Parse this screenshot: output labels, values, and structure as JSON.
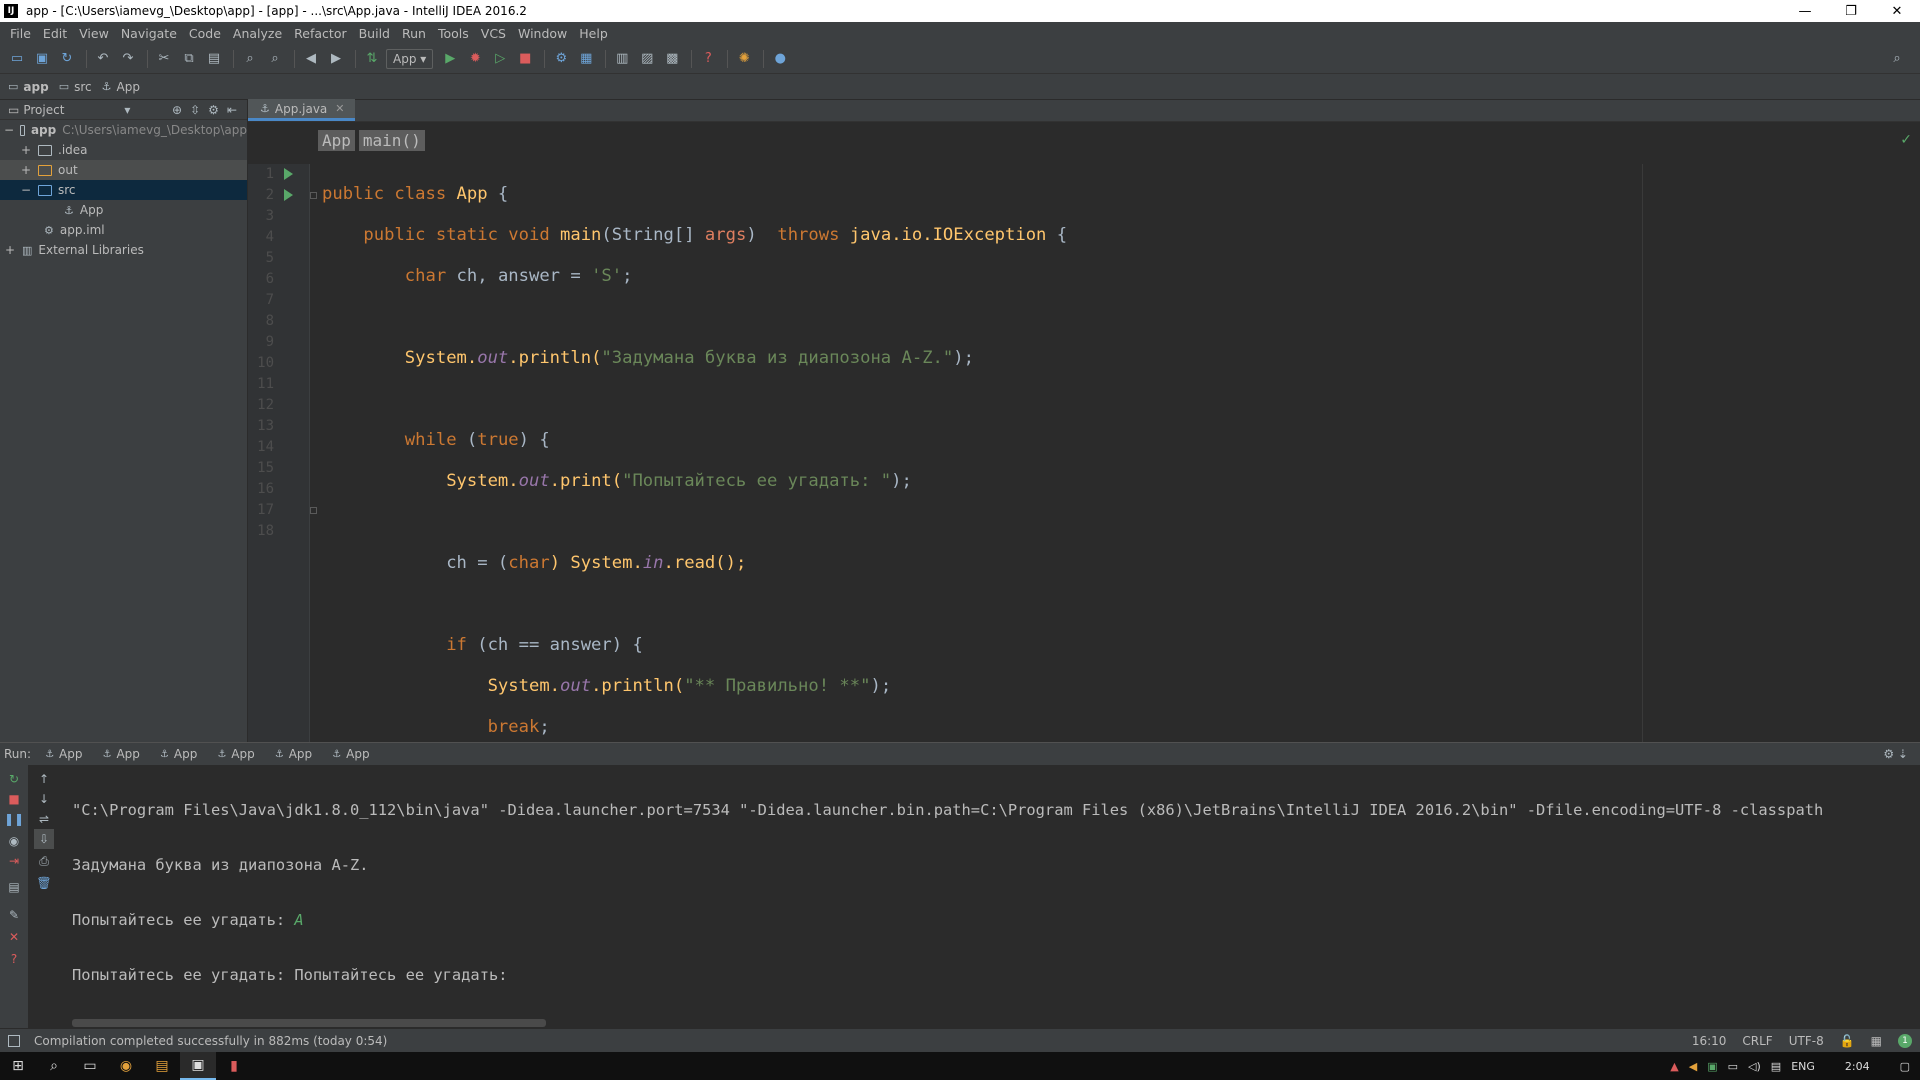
{
  "window": {
    "title": "app - [C:\\Users\\iamevg_\\Desktop\\app] - [app] - ...\\src\\App.java - IntelliJ IDEA 2016.2",
    "app_icon_letter": "IJ",
    "minimize": "—",
    "maximize": "❐",
    "close": "✕"
  },
  "menu": [
    "File",
    "Edit",
    "View",
    "Navigate",
    "Code",
    "Analyze",
    "Refactor",
    "Build",
    "Run",
    "Tools",
    "VCS",
    "Window",
    "Help"
  ],
  "toolbar": {
    "run_config": "App ▾"
  },
  "navbar": {
    "crumbs": [
      "app",
      "src",
      "App"
    ]
  },
  "project": {
    "title": "Project",
    "tree": [
      {
        "name": "app",
        "path": "C:\\Users\\iamevg_\\Desktop\\app"
      },
      {
        "name": ".idea"
      },
      {
        "name": "out"
      },
      {
        "name": "src"
      },
      {
        "name": "App"
      },
      {
        "name": "app.iml"
      },
      {
        "name": "External Libraries"
      }
    ]
  },
  "editor": {
    "tab": "App.java",
    "code_breadcrumb": [
      "App",
      "main()"
    ],
    "line_numbers": [
      "1",
      "2",
      "3",
      "4",
      "5",
      "6",
      "7",
      "8",
      "9",
      "10",
      "11",
      "12",
      "13",
      "14",
      "15",
      "16",
      "17",
      "18"
    ]
  },
  "code": {
    "l1_kw": "public class ",
    "l1_cls": "App",
    "l1_rest": " {",
    "l2_kw1": "public static void ",
    "l2_m": "main",
    "l2_p1": "(String[] ",
    "l2_args": "args",
    "l2_p2": ")  ",
    "l2_kw2": "throws ",
    "l2_exc": "java.io.IOException",
    "l2_rest": " {",
    "l3_kw": "char ",
    "l3_a": "ch, answer = ",
    "l3_str": "'S'",
    "l3_b": ";",
    "l5_a": "System.",
    "l5_f": "out",
    "l5_b": ".println(",
    "l5_str": "\"Задумана буква из диапозона A-Z.\"",
    "l5_c": ");",
    "l7_kw": "while ",
    "l7_a": "(",
    "l7_kw2": "true",
    "l7_b": ") {",
    "l8_a": "System.",
    "l8_f": "out",
    "l8_b": ".print(",
    "l8_str": "\"Попытайтесь ее угадать: \"",
    "l8_c": ");",
    "l10_a": "ch = (",
    "l10_kw": "char",
    "l10_b": ") System.",
    "l10_f": "in",
    "l10_c": ".read();",
    "l12_kw": "if ",
    "l12_a": "(ch == answer) {",
    "l13_a": "System.",
    "l13_f": "out",
    "l13_b": ".println(",
    "l13_str": "\"** Правильно! **\"",
    "l13_c": ");",
    "l14_kw": "break",
    "l14_a": ";",
    "l15": "}",
    "l16": "}",
    "l17": "}",
    "l18": "}"
  },
  "run": {
    "label": "Run:",
    "tabs": [
      "App",
      "App",
      "App",
      "App",
      "App",
      "App"
    ],
    "console": [
      "\"C:\\Program Files\\Java\\jdk1.8.0_112\\bin\\java\" -Didea.launcher.port=7534 \"-Didea.launcher.bin.path=C:\\Program Files (x86)\\JetBrains\\IntelliJ IDEA 2016.2\\bin\" -Dfile.encoding=UTF-8 -classpath",
      "Задумана буква из диапозона A-Z.",
      "Попытайтесь ее угадать: ",
      "Попытайтесь ее угадать: Попытайтесь ее угадать:"
    ],
    "user_input": "A"
  },
  "status": {
    "message": "Compilation completed successfully in 882ms (today 0:54)",
    "position": "16:10",
    "line_sep": "CRLF",
    "encoding": "UTF-8",
    "badge": "1"
  },
  "taskbar": {
    "lang": "ENG",
    "time": "2:04"
  },
  "colors": {
    "keyword": "#cc7832",
    "string": "#6a8759",
    "class": "#ffc66d",
    "field": "#9876aa",
    "run_green": "#59a869"
  }
}
